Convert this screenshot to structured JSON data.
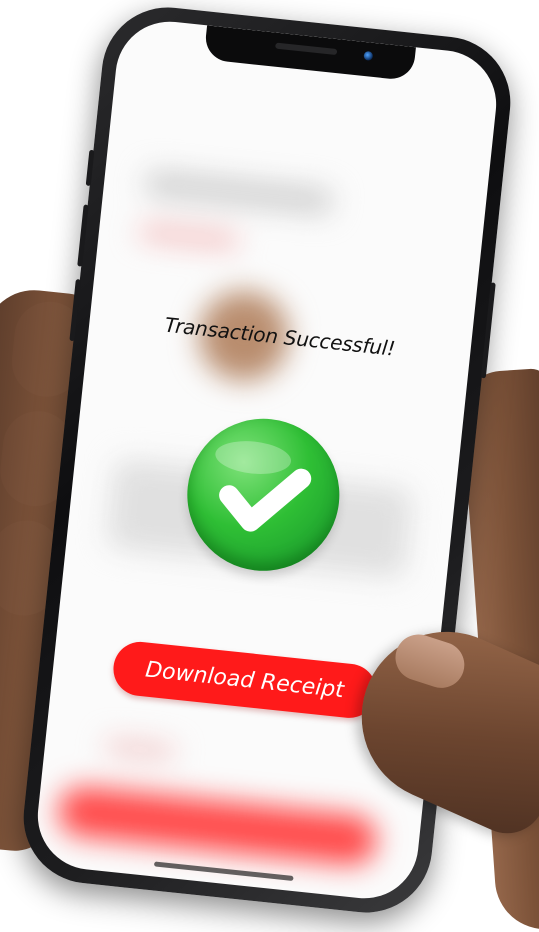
{
  "screen": {
    "title": "Transaction Successful!",
    "status_icon": "check-circle-icon",
    "download_button_label": "Download Receipt"
  },
  "colors": {
    "accent_red": "#ff1a1a",
    "success_green": "#2fbf35",
    "phone_frame": "#111113",
    "screen_background": "#fbfbfb"
  }
}
